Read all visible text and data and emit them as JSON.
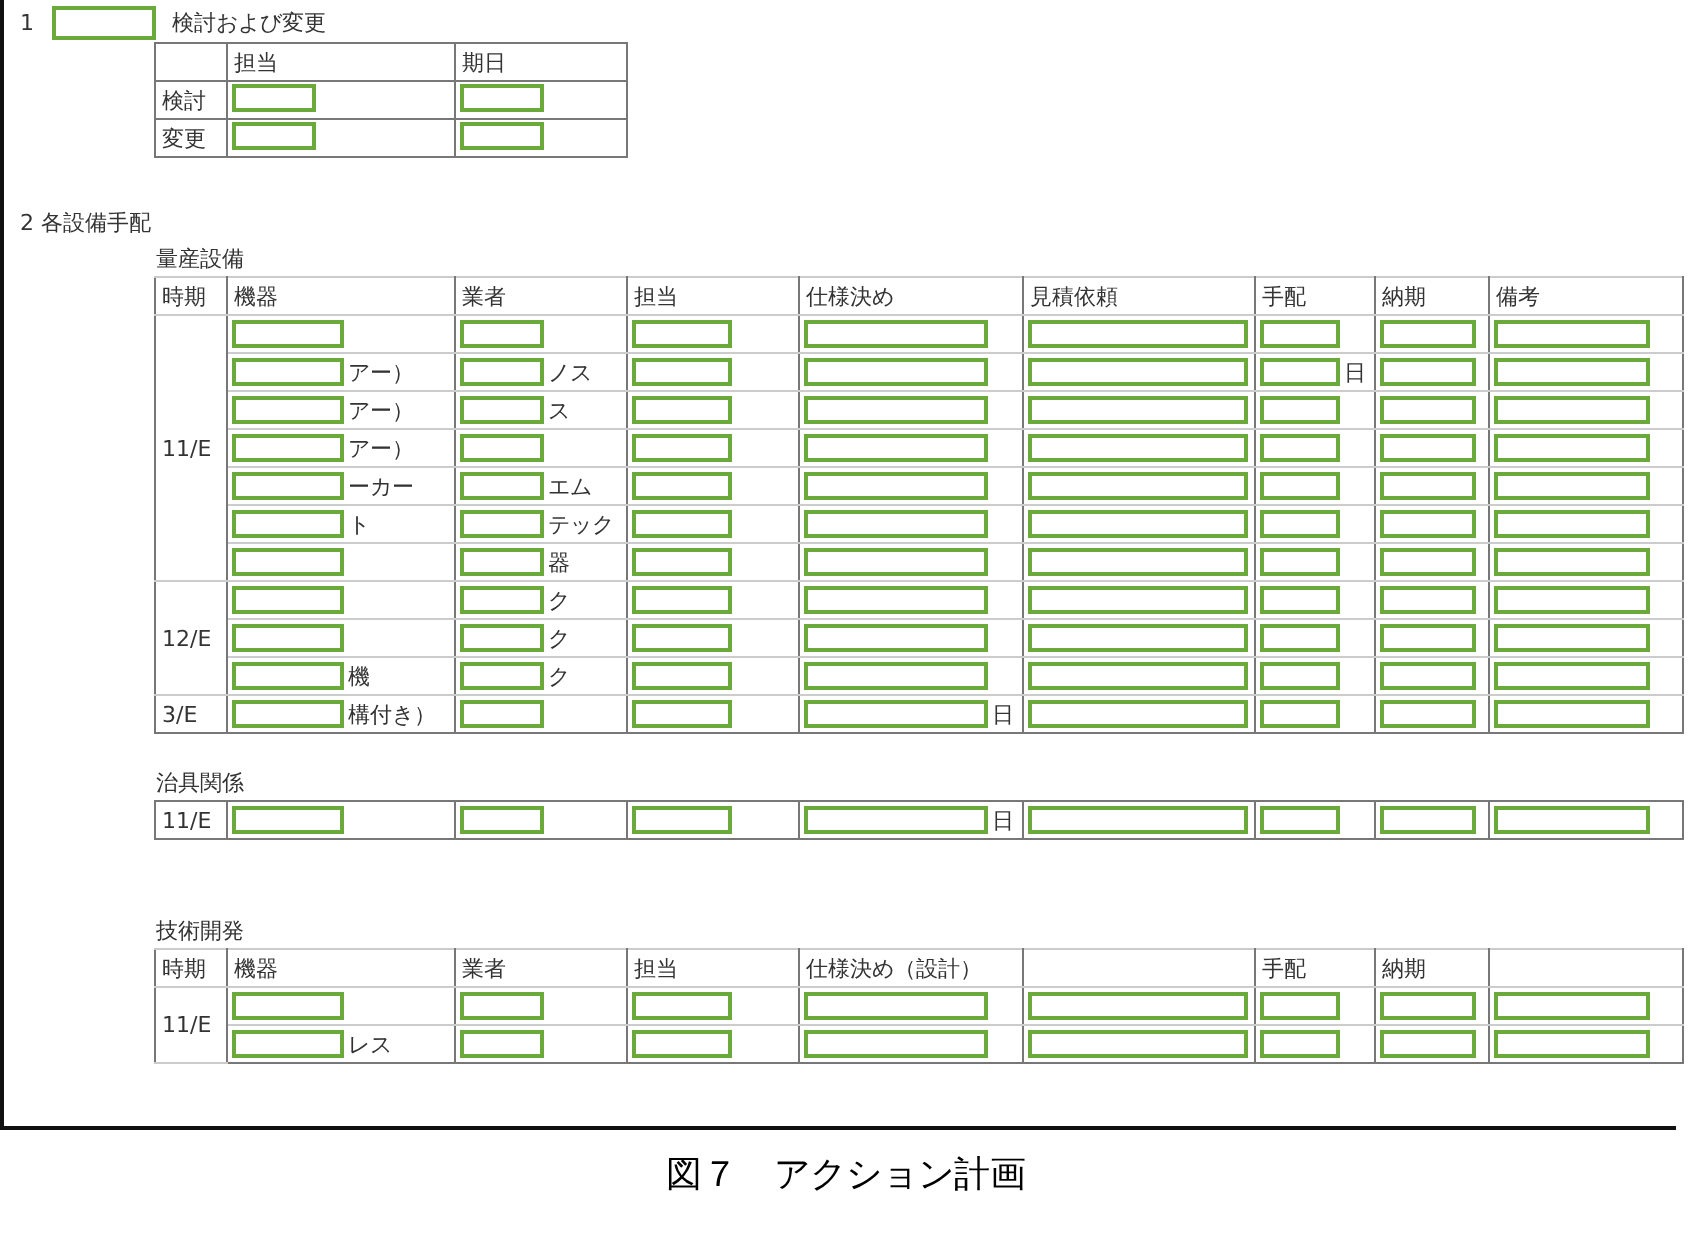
{
  "section1": {
    "number": "1",
    "title": "検討および変更",
    "columns": [
      "担当",
      "期日"
    ],
    "rows": [
      {
        "label": "検討"
      },
      {
        "label": "変更"
      }
    ]
  },
  "section2": {
    "number": "2",
    "title": "各設備手配",
    "tables": [
      {
        "title": "量産設備",
        "columns": [
          {
            "label": "時期"
          },
          {
            "label": "機器"
          },
          {
            "label": "業者"
          },
          {
            "label": "担当"
          },
          {
            "label": "仕様決め"
          },
          {
            "label": "見積依頼"
          },
          {
            "label": "手配"
          },
          {
            "label": "納期"
          },
          {
            "label": "備考"
          }
        ],
        "groups": [
          {
            "period": "11/E",
            "rows": [
              {
                "cells": [
                  {},
                  {},
                  {},
                  {},
                  {},
                  {},
                  {},
                  {}
                ]
              },
              {
                "cells": [
                  {
                    "text": "アー）"
                  },
                  {
                    "text": "ノス"
                  },
                  {},
                  {},
                  {},
                  {
                    "text": "日"
                  },
                  {},
                  {}
                ]
              },
              {
                "cells": [
                  {
                    "text": "アー）"
                  },
                  {
                    "text": "ス"
                  },
                  {},
                  {},
                  {},
                  {},
                  {},
                  {}
                ]
              },
              {
                "cells": [
                  {
                    "text": "アー）"
                  },
                  {},
                  {},
                  {},
                  {},
                  {},
                  {},
                  {}
                ]
              },
              {
                "cells": [
                  {
                    "text": "ーカー"
                  },
                  {
                    "text": "エム"
                  },
                  {},
                  {},
                  {},
                  {},
                  {},
                  {}
                ]
              },
              {
                "cells": [
                  {
                    "text": "ト"
                  },
                  {
                    "text": "テック"
                  },
                  {},
                  {},
                  {},
                  {},
                  {},
                  {}
                ]
              },
              {
                "cells": [
                  {},
                  {
                    "text": "器"
                  },
                  {},
                  {},
                  {},
                  {},
                  {},
                  {}
                ]
              }
            ]
          },
          {
            "period": "12/E",
            "rows": [
              {
                "cells": [
                  {},
                  {
                    "text": "ク"
                  },
                  {},
                  {},
                  {},
                  {},
                  {},
                  {}
                ]
              },
              {
                "cells": [
                  {},
                  {
                    "text": "ク"
                  },
                  {},
                  {},
                  {},
                  {},
                  {},
                  {}
                ]
              },
              {
                "cells": [
                  {
                    "text": "機"
                  },
                  {
                    "text": "ク"
                  },
                  {},
                  {},
                  {},
                  {},
                  {},
                  {}
                ]
              }
            ]
          },
          {
            "period": "3/E",
            "rows": [
              {
                "cells": [
                  {
                    "text": "構付き）"
                  },
                  {},
                  {},
                  {
                    "text": "日"
                  },
                  {},
                  {},
                  {},
                  {}
                ]
              }
            ]
          }
        ]
      },
      {
        "title": "治具関係",
        "groups": [
          {
            "period": "11/E",
            "rows": [
              {
                "cells": [
                  {},
                  {},
                  {},
                  {
                    "text": "日"
                  },
                  {},
                  {},
                  {},
                  {}
                ]
              }
            ]
          }
        ]
      },
      {
        "title": "技術開発",
        "columns": [
          {
            "label": "時期"
          },
          {
            "label": "機器"
          },
          {
            "label": "業者"
          },
          {
            "label": "担当"
          },
          {
            "label": "仕様決め（設計）"
          },
          {},
          {
            "label": "手配"
          },
          {
            "label": "納期"
          },
          {}
        ],
        "groups": [
          {
            "period": "11/E",
            "rows": [
              {
                "cells": [
                  {},
                  {},
                  {},
                  {},
                  {},
                  {},
                  {},
                  {}
                ]
              },
              {
                "cells": [
                  {
                    "text": "レス"
                  },
                  {},
                  {},
                  {},
                  {},
                  {},
                  {},
                  {}
                ]
              }
            ]
          }
        ]
      }
    ]
  },
  "caption": "図７　アクション計画"
}
